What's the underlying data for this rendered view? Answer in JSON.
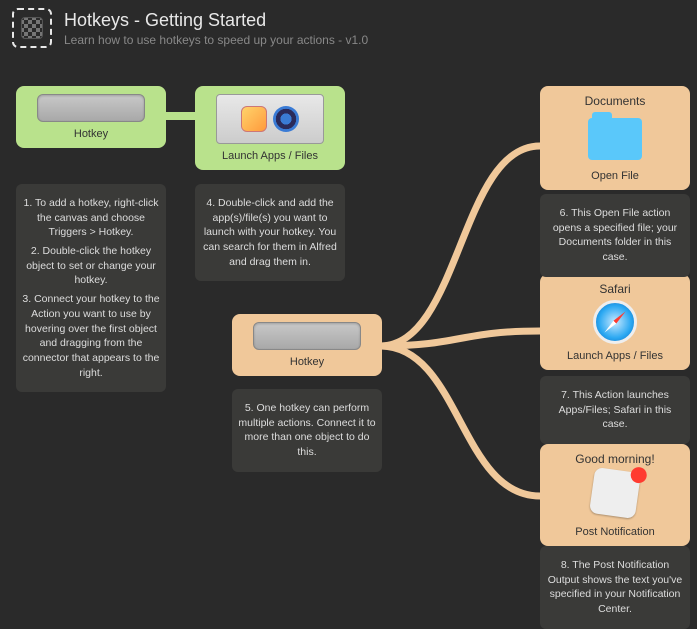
{
  "header": {
    "title": "Hotkeys - Getting Started",
    "subtitle": "Learn how to use hotkeys to speed up your actions - v1.0"
  },
  "nodes": {
    "hotkey1": {
      "label": "Hotkey"
    },
    "launch1": {
      "label": "Launch Apps / Files"
    },
    "hotkey2": {
      "label": "Hotkey"
    },
    "openfile": {
      "title": "Documents",
      "label": "Open File"
    },
    "safari": {
      "title": "Safari",
      "label": "Launch Apps / Files"
    },
    "notif": {
      "title": "Good morning!",
      "label": "Post Notification"
    }
  },
  "captions": {
    "c1a": "1. To add a hotkey, right-click the canvas and choose Triggers > Hotkey.",
    "c1b": "2. Double-click the hotkey object to set or change your hotkey.",
    "c1c": "3. Connect your hotkey to the Action you want to use by hovering over the first object and dragging from the connector that appears to the right.",
    "c4": "4. Double-click and add the app(s)/file(s) you want to launch with your hotkey. You can search for them in Alfred and drag them in.",
    "c5": "5. One hotkey can perform multiple actions. Connect it to more than one object to do this.",
    "c6": "6. This Open File action opens a specified file; your Documents folder in this case.",
    "c7": "7. This Action launches Apps/Files; Safari in this case.",
    "c8": "8. The Post Notification Output shows the text you've specified in your Notification Center."
  },
  "colors": {
    "trigger": "#b9e28c",
    "action": "#f0c89a"
  }
}
